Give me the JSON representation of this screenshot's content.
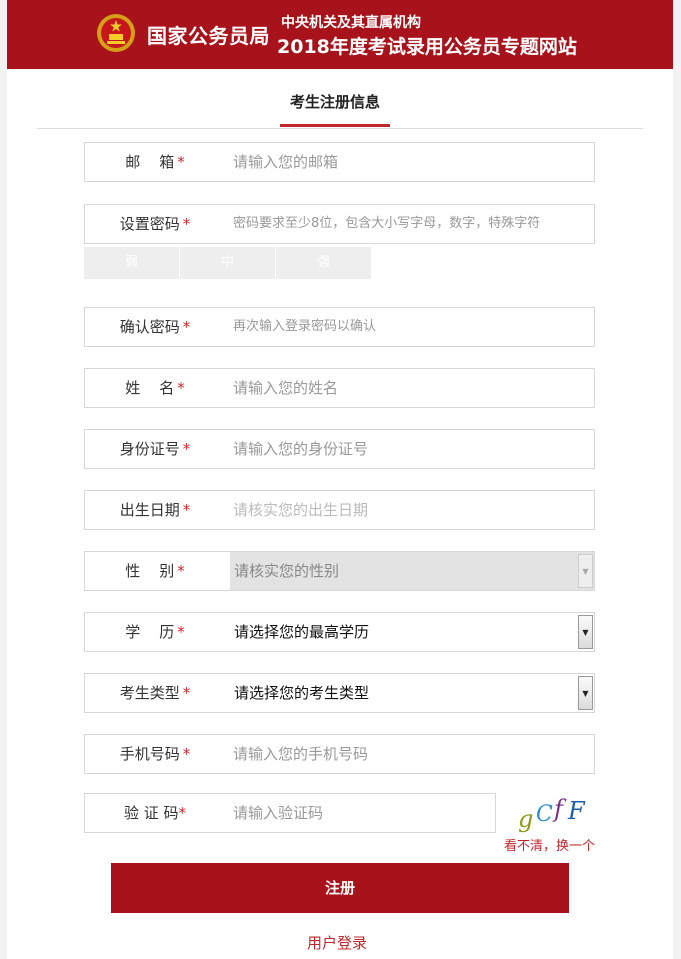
{
  "header": {
    "org_name": "国家公务员局",
    "subtitle_1": "中央机关及其直属机构",
    "subtitle_2": "2018年度考试录用公务员专题网站"
  },
  "tab": {
    "title": "考生注册信息"
  },
  "required_mark": "*",
  "form": {
    "email": {
      "label": "邮    箱",
      "placeholder": "请输入您的邮箱"
    },
    "password": {
      "label": "设置密码",
      "placeholder": "密码要求至少8位，包含大小写字母，数字，特殊字符"
    },
    "strength": [
      "弱",
      "中",
      "强"
    ],
    "confirm_password": {
      "label": "确认密码",
      "placeholder": "再次输入登录密码以确认"
    },
    "name": {
      "label": "姓    名",
      "placeholder": "请输入您的姓名"
    },
    "id_number": {
      "label": "身份证号",
      "placeholder": "请输入您的身份证号"
    },
    "birth_date": {
      "label": "出生日期",
      "placeholder": "请核实您的出生日期"
    },
    "gender": {
      "label": "性    别",
      "value": "请核实您的性别"
    },
    "education": {
      "label": "学    历",
      "value": "请选择您的最高学历"
    },
    "candidate_type": {
      "label": "考生类型",
      "value": "请选择您的考生类型"
    },
    "phone": {
      "label": "手机号码",
      "placeholder": "请输入您的手机号码"
    },
    "captcha": {
      "label": "验 证 码",
      "placeholder": "请输入验证码",
      "image_text": "gCfF",
      "refresh_label": "看不清，换一个"
    }
  },
  "actions": {
    "submit_label": "注册",
    "login_label": "用户登录"
  },
  "colors": {
    "brand_red": "#a8121b",
    "accent_red": "#c0282d"
  }
}
